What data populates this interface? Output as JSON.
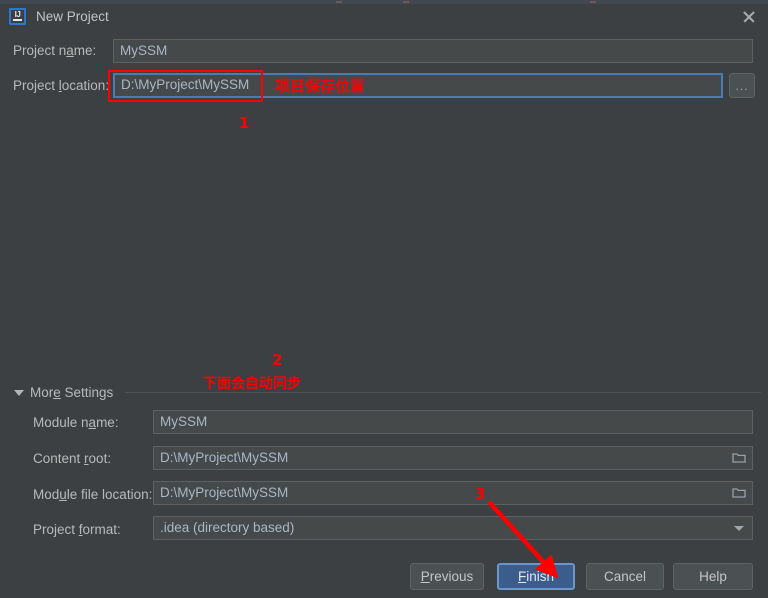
{
  "window": {
    "title": "New Project",
    "icon_name": "intellij-idea-icon",
    "close_label": "✕"
  },
  "form": {
    "project_name": {
      "label_pre": "Project n",
      "label_mn": "a",
      "label_post": "me:",
      "label_full": "Project name:",
      "value": "MySSM"
    },
    "project_location": {
      "label_pre": "Project ",
      "label_mn": "l",
      "label_post": "ocation:",
      "label_full": "Project location:",
      "value": "D:\\MyProject\\MySSM"
    },
    "browse_button": {
      "label": "...",
      "name": "browse-ellipsis-button"
    }
  },
  "more_settings": {
    "label_pre": "Mor",
    "label_mn": "e",
    "label_post": " Settings",
    "label_full": "More Settings",
    "expanded": true,
    "rows": [
      {
        "label_pre": "Module n",
        "label_mn": "a",
        "label_post": "me:",
        "label_full": "Module name:",
        "value": "MySSM",
        "widget": "text",
        "icon": null,
        "name": "module-name"
      },
      {
        "label_pre": "Content ",
        "label_mn": "r",
        "label_post": "oot:",
        "label_full": "Content root:",
        "value": "D:\\MyProject\\MySSM",
        "widget": "text",
        "icon": "folder-icon",
        "name": "content-root"
      },
      {
        "label_pre": "Mod",
        "label_mn": "u",
        "label_post": "le file location:",
        "label_full": "Module file location:",
        "value": "D:\\MyProject\\MySSM",
        "widget": "text",
        "icon": "folder-icon",
        "name": "module-file-location"
      },
      {
        "label_pre": "Project ",
        "label_mn": "f",
        "label_post": "ormat:",
        "label_full": "Project format:",
        "value": ".idea (directory based)",
        "widget": "combo",
        "icon": "chevron-down-icon",
        "name": "project-format"
      }
    ]
  },
  "buttons": [
    {
      "pre": "",
      "mn": "P",
      "post": "revious",
      "full": "Previous",
      "primary": false,
      "name": "previous-button"
    },
    {
      "pre": "",
      "mn": "F",
      "post": "inish",
      "full": "Finish",
      "primary": true,
      "name": "finish-button"
    },
    {
      "pre": "Cancel",
      "mn": "",
      "post": "",
      "full": "Cancel",
      "primary": false,
      "name": "cancel-button"
    },
    {
      "pre": "Help",
      "mn": "",
      "post": "",
      "full": "Help",
      "primary": false,
      "name": "help-button"
    }
  ],
  "annotations": {
    "color": "#fe0000",
    "note_1": {
      "text": "项目保存位置",
      "number": "1"
    },
    "note_2": {
      "text": "下面会自动同步",
      "number": "2"
    },
    "note_3": {
      "number": "3"
    }
  }
}
